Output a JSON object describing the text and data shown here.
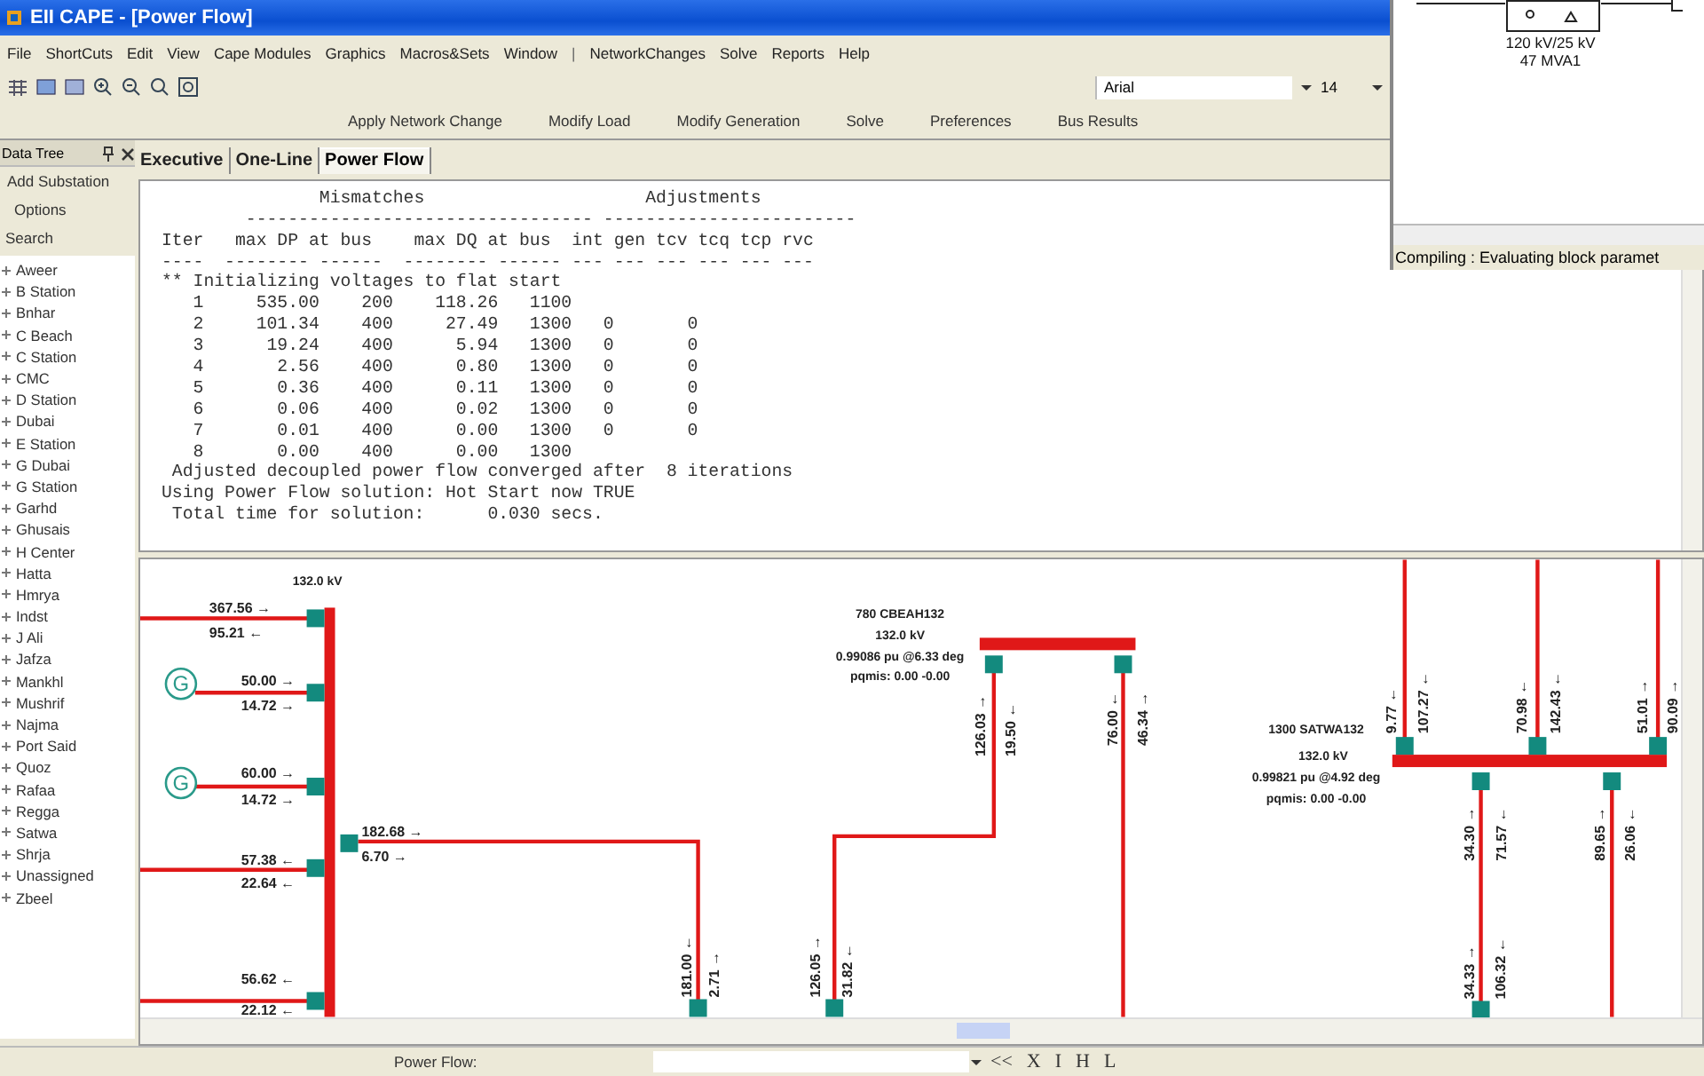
{
  "window": {
    "title": "EII CAPE - [Power Flow]"
  },
  "menu": [
    {
      "label": "File",
      "kind": "item"
    },
    {
      "label": "ShortCuts",
      "kind": "item"
    },
    {
      "label": "Edit",
      "kind": "item"
    },
    {
      "label": "View",
      "kind": "item"
    },
    {
      "label": "Cape Modules",
      "kind": "item"
    },
    {
      "label": "Graphics",
      "kind": "item"
    },
    {
      "label": "Macros&Sets",
      "kind": "item"
    },
    {
      "label": "Window",
      "kind": "item"
    },
    {
      "label": "|",
      "kind": "separator"
    },
    {
      "label": "NetworkChanges",
      "kind": "item"
    },
    {
      "label": "Solve",
      "kind": "item"
    },
    {
      "label": "Reports",
      "kind": "item"
    },
    {
      "label": "Help",
      "kind": "item"
    }
  ],
  "toolbar": {
    "font": "Arial",
    "size": "14"
  },
  "commands": [
    "Apply Network Change",
    "Modify Load",
    "Modify Generation",
    "Solve",
    "Preferences",
    "Bus Results"
  ],
  "data_tree": {
    "title": "Data Tree",
    "actions": [
      "Add Substation",
      "Options",
      "Search"
    ],
    "items": [
      {
        "label": "Aweer",
        "expanded": false
      },
      {
        "label": "B Station",
        "expanded": false
      },
      {
        "label": "Bnhar",
        "expanded": false
      },
      {
        "label": "C Beach",
        "expanded": false
      },
      {
        "label": "C Station",
        "expanded": false
      },
      {
        "label": "CMC",
        "expanded": false
      },
      {
        "label": "D Station",
        "expanded": false
      },
      {
        "label": "Dubai",
        "expanded": false
      },
      {
        "label": "E Station",
        "expanded": false
      },
      {
        "label": "G Dubai",
        "expanded": false
      },
      {
        "label": "G Station",
        "expanded": false
      },
      {
        "label": "Garhd",
        "expanded": false
      },
      {
        "label": "Ghusais",
        "expanded": false
      },
      {
        "label": "H Center",
        "expanded": false
      },
      {
        "label": "Hatta",
        "expanded": false
      },
      {
        "label": "Hmrya",
        "expanded": false
      },
      {
        "label": "Indst",
        "expanded": false
      },
      {
        "label": "J Ali",
        "expanded": false
      },
      {
        "label": "Jafza",
        "expanded": false
      },
      {
        "label": "Mankhl",
        "expanded": false
      },
      {
        "label": "Mushrif",
        "expanded": false
      },
      {
        "label": "Najma",
        "expanded": false
      },
      {
        "label": "Port Said",
        "expanded": false
      },
      {
        "label": "Quoz",
        "expanded": false
      },
      {
        "label": "Rafaa",
        "expanded": false
      },
      {
        "label": "Regga",
        "expanded": false
      },
      {
        "label": "Satwa",
        "expanded": false
      },
      {
        "label": "Shrja",
        "expanded": false
      },
      {
        "label": "Unassigned",
        "expanded": false
      },
      {
        "label": "Zbeel",
        "expanded": false
      }
    ]
  },
  "tabs": [
    {
      "label": "Executive",
      "selected": false
    },
    {
      "label": "One-Line",
      "selected": false
    },
    {
      "label": "Power Flow",
      "selected": true
    }
  ],
  "output": {
    "lines": [
      "               Mismatches                     Adjustments",
      "        --------------------------------- ------------------------",
      "Iter   max DP at bus    max DQ at bus  int gen tcv tcq tcp rvc",
      "----  -------- ------  -------- ------ --- --- --- --- --- ---",
      "** Initializing voltages to flat start",
      "   1     535.00    200    118.26   1100",
      "   2     101.34    400     27.49   1300   0       0",
      "   3      19.24    400      5.94   1300   0       0",
      "   4       2.56    400      0.80   1300   0       0",
      "   5       0.36    400      0.11   1300   0       0",
      "   6       0.06    400      0.02   1300   0       0",
      "   7       0.01    400      0.00   1300   0       0",
      "   8       0.00    400      0.00   1300",
      " Adjusted decoupled power flow converged after  8 iterations",
      "Using Power Flow solution: Hot Start now TRUE",
      " Total time for solution:      0.030 secs."
    ]
  },
  "diagram": {
    "buses": [
      {
        "kv": "132.0 kV"
      },
      {
        "name": "780 CBEAH132",
        "kv": "132.0 kV",
        "pu": "0.99086 pu @6.33 deg",
        "pqmis": "pqmis: 0.00 -0.00"
      },
      {
        "name": "1300 SATWA132",
        "kv": "132.0 kV",
        "pu": "0.99821 pu @4.92 deg",
        "pqmis": "pqmis: 0.00 -0.00"
      }
    ],
    "generators": [
      {
        "label": "G"
      },
      {
        "label": "G"
      }
    ],
    "flows": [
      "367.56 →",
      "95.21 ←",
      "50.00 →",
      "14.72 →",
      "60.00 →",
      "14.72 →",
      "57.38 ←",
      "22.64 ←",
      "56.62 ←",
      "22.12 ←",
      "182.68 →",
      "6.70 →",
      "181.00 ←",
      "2.71 →",
      "126.05 →",
      "31.82 ←",
      "126.03 →",
      "19.50 ←",
      "76.00 ←",
      "46.34 →",
      "9.77 ←",
      "107.27 ←",
      "70.98 ←",
      "142.43 ←",
      "51.01 →",
      "90.09 →",
      "34.30 →",
      "71.57 ←",
      "89.65 →",
      "26.06 ←",
      "34.33 →",
      "106.32 ←"
    ]
  },
  "simulink": {
    "labels": [
      "120 kV/25 kV",
      "47 MVA1"
    ],
    "status": "Compiling : Evaluating block paramet"
  },
  "status_bar": {
    "label": "Power Flow:",
    "nav": "<<",
    "buttons": [
      "X",
      "I",
      "H",
      "L"
    ]
  }
}
